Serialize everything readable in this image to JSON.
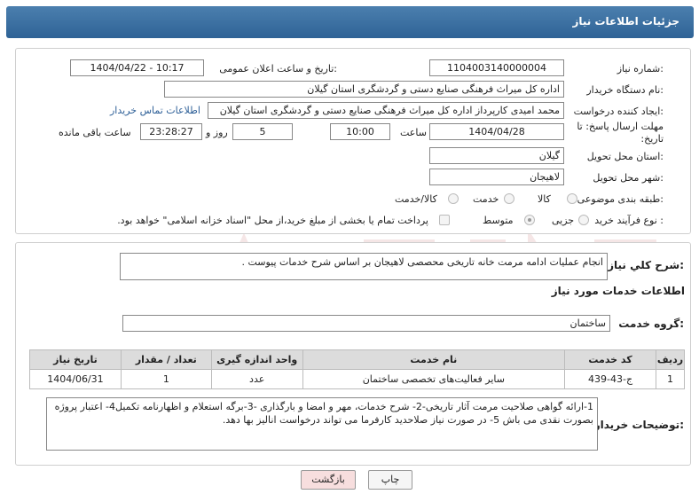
{
  "header": {
    "title": "جزئیات اطلاعات نیاز"
  },
  "form": {
    "need_number_label": "شماره نیاز:",
    "need_number": "1104003140000004",
    "announce_label": "تاریخ و ساعت اعلان عمومی:",
    "announce_value": "1404/04/22 - 10:17",
    "buyer_org_label": "نام دستگاه خریدار:",
    "buyer_org": "اداره کل میراث فرهنگی  صنایع دستی و گردشگری استان گیلان",
    "requester_label": "ایجاد کننده درخواست:",
    "requester": "محمد امیدی کارپرداز اداره کل میراث فرهنگی  صنایع دستی و گردشگری استان گیلان",
    "contact_link": "اطلاعات تماس خریدار",
    "deadline_label": "مهلت ارسال پاسخ: تا تاریخ:",
    "deadline_date": "1404/04/28",
    "time_label": "ساعت",
    "deadline_time": "10:00",
    "days_value": "5",
    "days_label": "روز و",
    "remaining_time": "23:28:27",
    "remaining_label": "ساعت باقی مانده",
    "province_label": "استان محل تحویل:",
    "province": "گیلان",
    "city_label": "شهر محل تحویل:",
    "city": "لاهیجان",
    "category_label": "طبقه بندی موضوعی:",
    "category_options": [
      "کالا",
      "خدمت",
      "کالا/خدمت"
    ],
    "category_selected": "خدمت",
    "process_label": "نوع فرآیند خرید :",
    "process_options": [
      "جزیی",
      "متوسط"
    ],
    "process_selected": "متوسط",
    "payment_note": "پرداخت تمام یا بخشی از مبلغ خرید،از محل \"اسناد خزانه اسلامی\" خواهد بود."
  },
  "description": {
    "label": "شرح كلي نياز:",
    "text": "انجام عملیات ادامه مرمت خانه تاریخی محصصی لاهیجان بر اساس شرح خدمات پیوست ."
  },
  "services": {
    "section_title": "اطلاعات خدمات مورد نیاز",
    "group_label": "گروه خدمت:",
    "group_value": "ساختمان",
    "columns": [
      "ردیف",
      "کد خدمت",
      "نام خدمت",
      "واحد اندازه گیری",
      "تعداد / مقدار",
      "تاریخ نیاز"
    ],
    "rows": [
      [
        "1",
        "ج-43-439",
        "سایر فعالیت‌های تخصصی ساختمان",
        "عدد",
        "1",
        "1404/06/31"
      ]
    ]
  },
  "buyer_notes": {
    "label": "توضیحات خریدار:",
    "text": "1-ارائه گواهی صلاحیت مرمت آثار تاریخی-2- شرح خدمات، مهر و امضا و بارگذاری -3-برگه استعلام و اظهارنامه تکمیل4- اعتبار پروژه بصورت نقدی می باش 5- در صورت نیاز صلاحدید کارفرما می تواند درخواست انالیز بها دهد."
  },
  "buttons": {
    "print": "چاپ",
    "back": "بازگشت"
  },
  "colors": {
    "header": "#3a6fa2",
    "back_button": "#f7dede",
    "link": "#2d5f97"
  }
}
